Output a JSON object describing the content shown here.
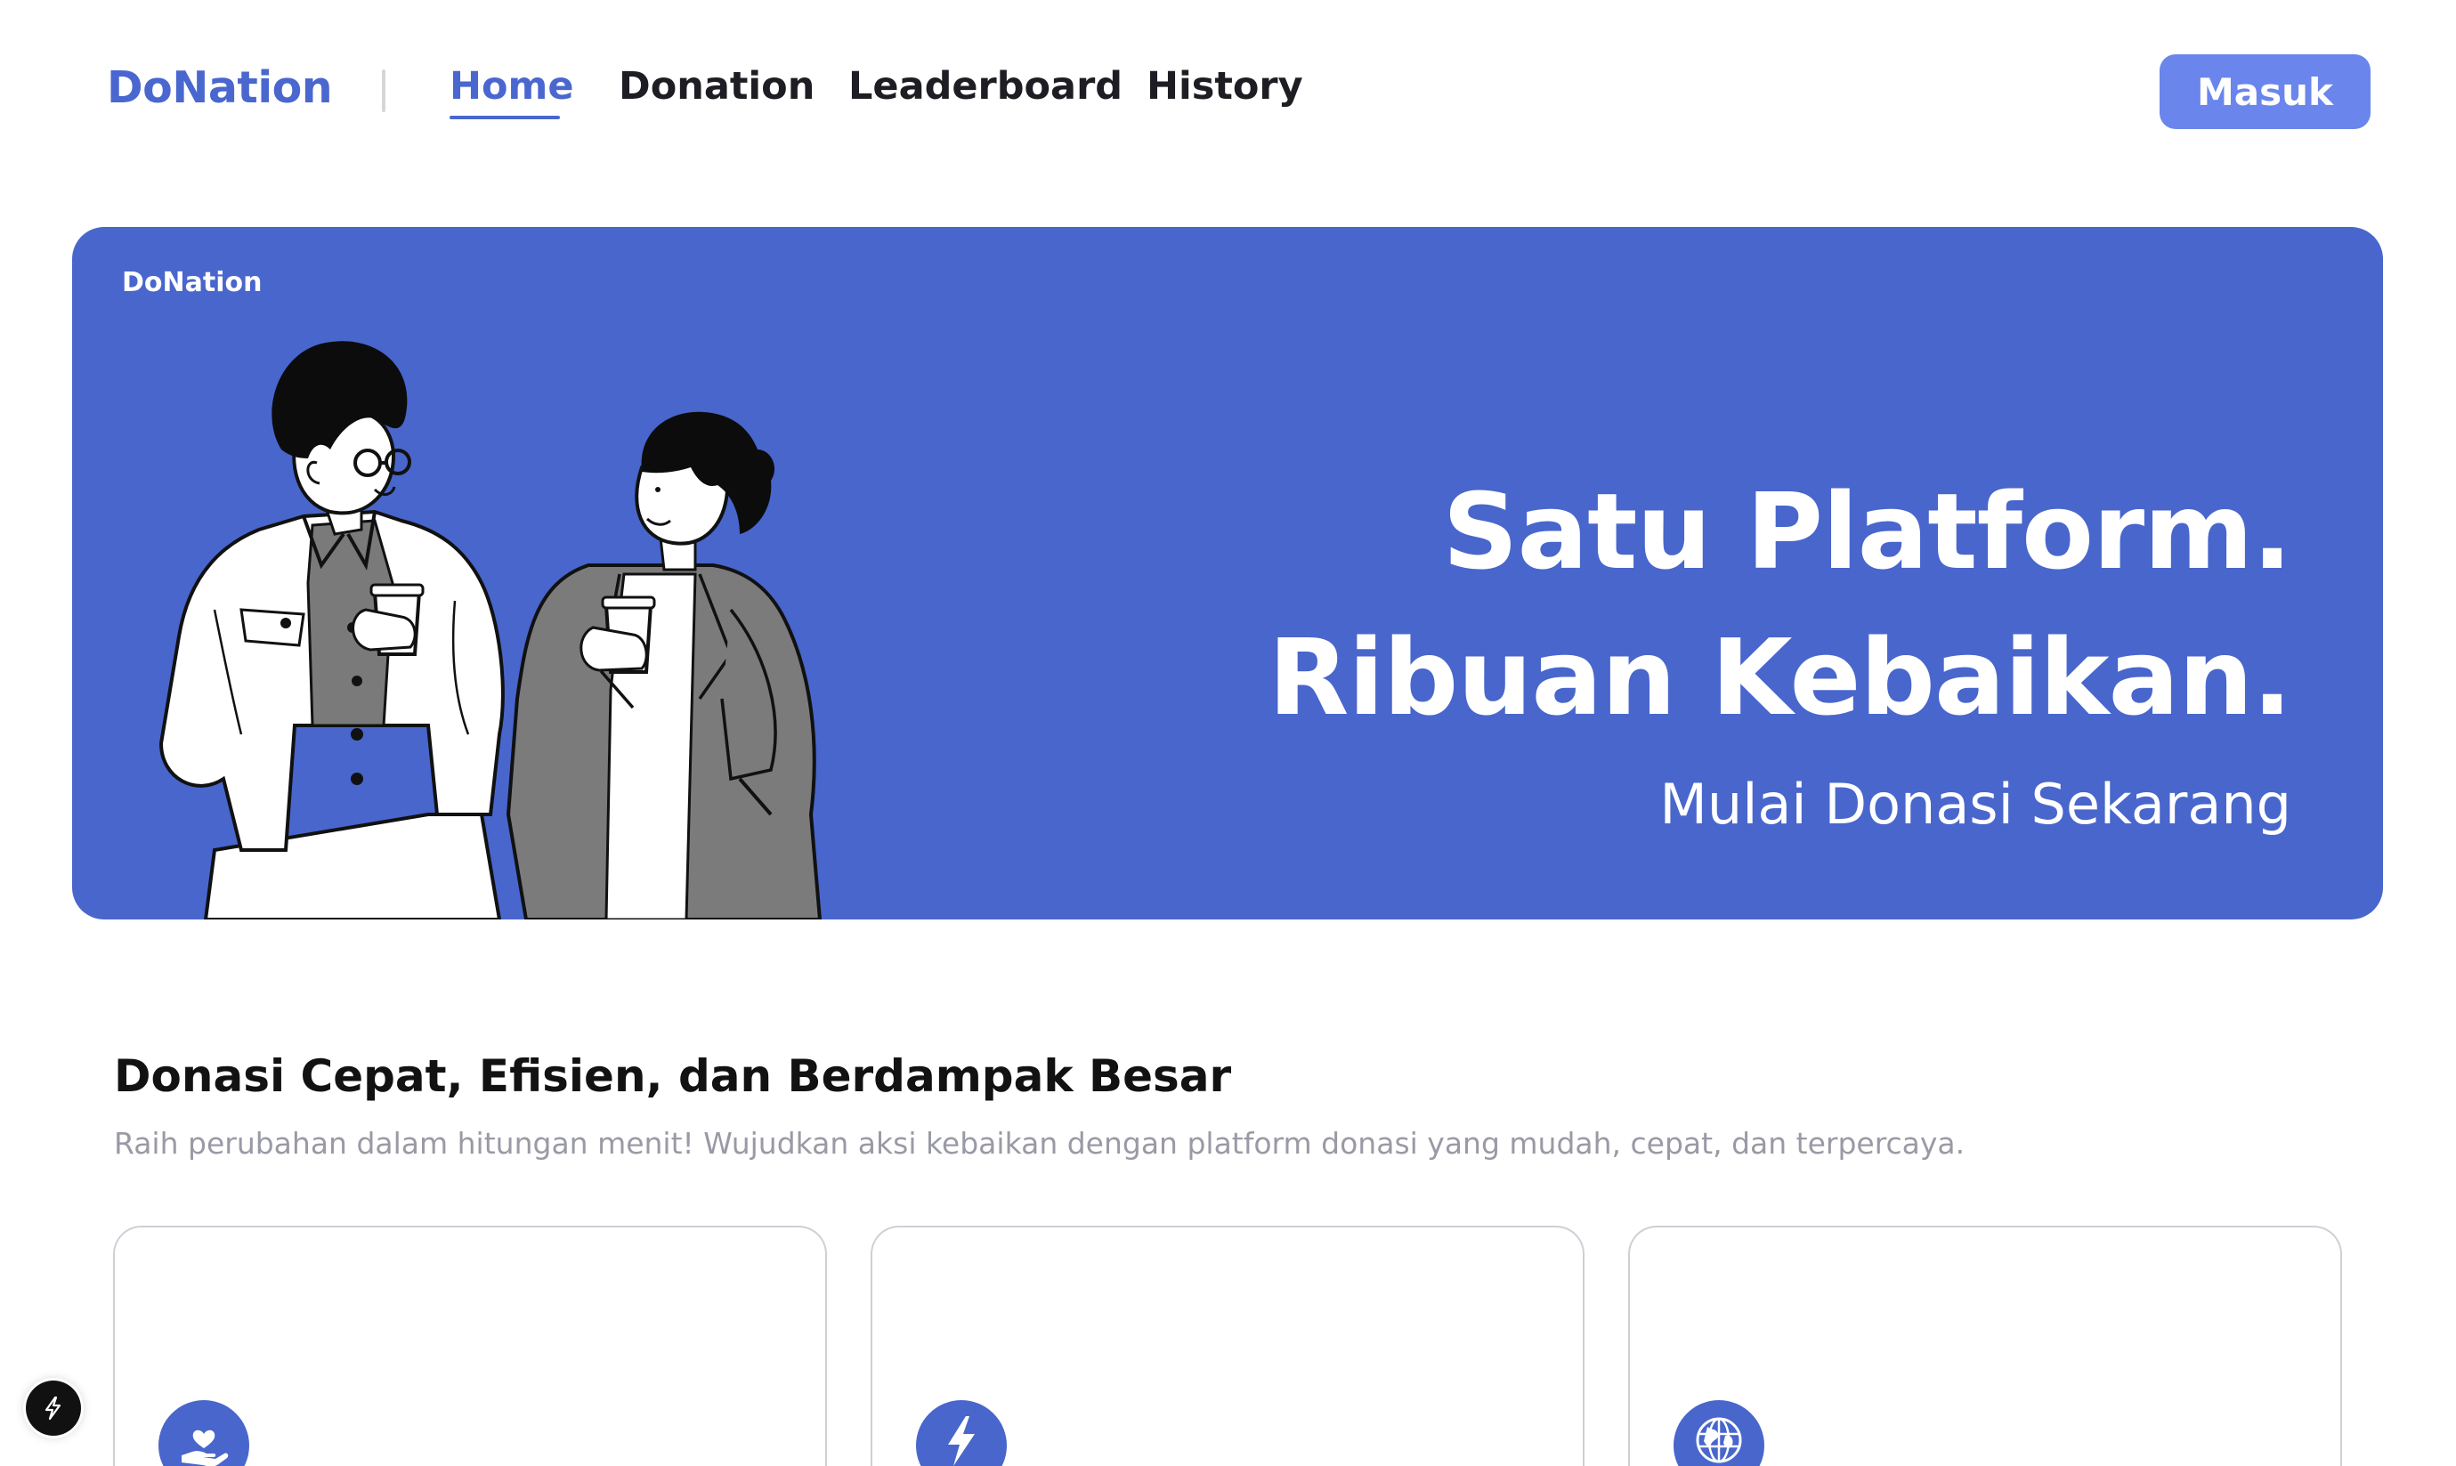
{
  "nav": {
    "logo": "DoNation",
    "items": [
      {
        "label": "Home",
        "active": true
      },
      {
        "label": "Donation",
        "active": false
      },
      {
        "label": "Leaderboard",
        "active": false
      },
      {
        "label": "History",
        "active": false
      }
    ],
    "login_label": "Masuk"
  },
  "hero": {
    "logo": "DoNation",
    "title_line1": "Satu Platform.",
    "title_line2": "Ribuan Kebaikan.",
    "subtitle": "Mulai Donasi Sekarang"
  },
  "features": {
    "title": "Donasi Cepat, Efisien, dan Berdampak Besar",
    "description": "Raih perubahan dalam hitungan menit! Wujudkan aksi kebaikan dengan platform donasi yang mudah, cepat, dan terpercaya.",
    "cards": [
      {
        "icon": "hand-heart-icon"
      },
      {
        "icon": "lightning-icon"
      },
      {
        "icon": "globe-icon"
      }
    ]
  },
  "colors": {
    "brand": "#4a67cf",
    "hero_bg": "#4866cc",
    "button": "#6a85ec"
  }
}
